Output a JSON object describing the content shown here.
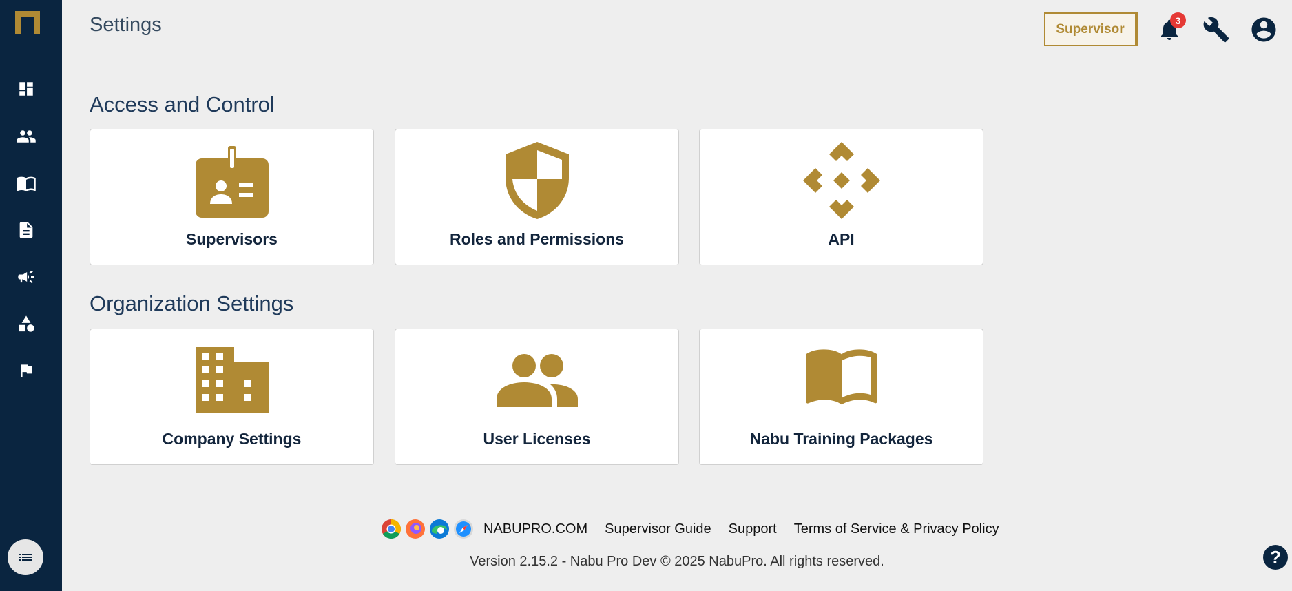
{
  "header": {
    "title": "Settings",
    "role_button": "Supervisor",
    "notification_count": "3"
  },
  "colors": {
    "accent": "#b08a34",
    "sidebar": "#0a2540",
    "background": "#eeeeee"
  },
  "sidebar": {
    "items": [
      {
        "icon": "dashboard-icon"
      },
      {
        "icon": "people-icon"
      },
      {
        "icon": "book-icon"
      },
      {
        "icon": "document-icon"
      },
      {
        "icon": "megaphone-icon"
      },
      {
        "icon": "shapes-icon"
      },
      {
        "icon": "flag-icon"
      }
    ],
    "bottom_icon": "list-icon"
  },
  "sections": [
    {
      "title": "Access and Control",
      "cards": [
        {
          "label": "Supervisors",
          "icon": "badge-icon"
        },
        {
          "label": "Roles and Permissions",
          "icon": "shield-icon"
        },
        {
          "label": "API",
          "icon": "api-icon"
        }
      ]
    },
    {
      "title": "Organization Settings",
      "cards": [
        {
          "label": "Company Settings",
          "icon": "building-icon"
        },
        {
          "label": "User Licenses",
          "icon": "group-icon"
        },
        {
          "label": "Nabu Training Packages",
          "icon": "open-book-icon"
        }
      ]
    }
  ],
  "footer": {
    "links": [
      "NABUPRO.COM",
      "Supervisor Guide",
      "Support",
      "Terms of Service & Privacy Policy"
    ],
    "version": "Version 2.15.2 - Nabu Pro Dev © 2025 NabuPro. All rights reserved.",
    "help": "?"
  }
}
